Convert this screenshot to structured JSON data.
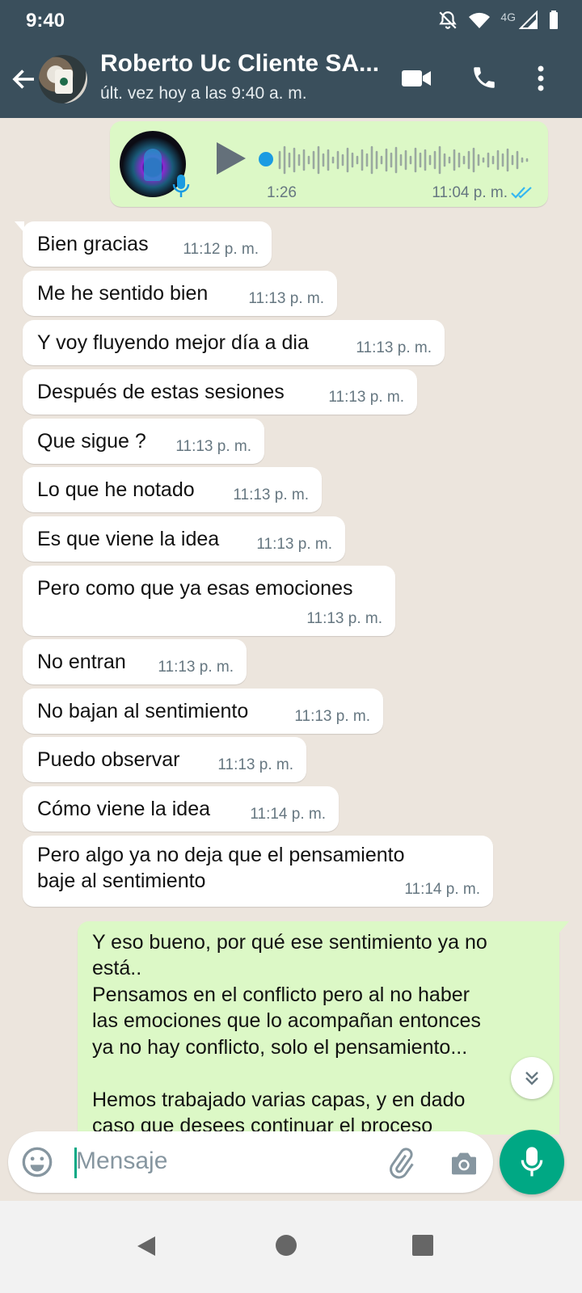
{
  "status_bar": {
    "time": "9:40",
    "network": "4G"
  },
  "header": {
    "contact_name": "Roberto Uc Cliente SA...",
    "last_seen": "últ. vez hoy a las 9:40 a. m."
  },
  "voice_note": {
    "duration": "1:26",
    "time": "11:04 p. m.",
    "read": true
  },
  "incoming_messages": [
    {
      "text": "Bien gracias",
      "time": "11:12 p. m."
    },
    {
      "text": "Me he sentido bien",
      "time": "11:13 p. m."
    },
    {
      "text": "Y voy fluyendo mejor día a dia",
      "time": "11:13 p. m."
    },
    {
      "text": "Después de estas sesiones",
      "time": "11:13 p. m."
    },
    {
      "text": "Que sigue ?",
      "time": "11:13 p. m."
    },
    {
      "text": "Lo que he notado",
      "time": "11:13 p. m."
    },
    {
      "text": "Es que viene la idea",
      "time": "11:13 p. m."
    },
    {
      "text": "Pero como que ya esas emociones",
      "time": "11:13 p. m."
    },
    {
      "text": "No entran",
      "time": "11:13 p. m."
    },
    {
      "text": "No bajan al sentimiento",
      "time": "11:13 p. m."
    },
    {
      "text": "Puedo observar",
      "time": "11:13 p. m."
    },
    {
      "text": "Cómo viene la idea",
      "time": "11:14 p. m."
    },
    {
      "text_lines": [
        "Pero algo ya no deja que el pensamiento",
        "baje al sentimiento"
      ],
      "time": "11:14 p. m."
    }
  ],
  "outgoing_message": {
    "lines": [
      "Y eso bueno, por qué ese sentimiento ya no",
      "está..",
      "Pensamos en el conflicto pero al no haber",
      "las emociones que lo acompañan entonces",
      "ya no hay conflicto, solo el pensamiento...",
      "",
      "Hemos trabajado varias capas, y en dado",
      "caso que desees continuar el proceso"
    ]
  },
  "composer": {
    "placeholder": "Mensaje"
  },
  "colors": {
    "header": "#3a4f5c",
    "outgoing_bubble": "#dcf8c6",
    "accent": "#00a884",
    "wallpaper": "#ece5dd"
  }
}
